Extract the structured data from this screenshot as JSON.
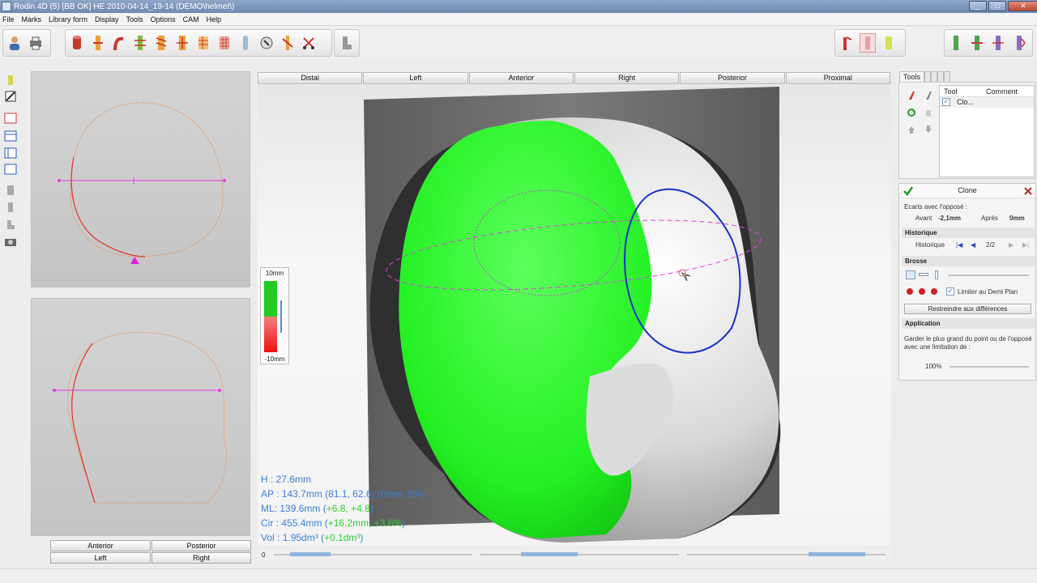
{
  "window": {
    "title": "Rodin 4D (5) [BB OK] HE 2010-04-14_19-14 (DEMO\\helmet\\)",
    "controls": [
      "_",
      "□",
      "✕"
    ]
  },
  "menu": [
    "File",
    "Marks",
    "Library form",
    "Display",
    "Tools",
    "Options",
    "CAM",
    "Help"
  ],
  "view_tabs": [
    "Distal",
    "Left",
    "Anterior",
    "Right",
    "Posterior",
    "Proximal"
  ],
  "left_buttons": {
    "anterior": "Anterior",
    "posterior": "Posterior",
    "left": "Left",
    "right": "Right"
  },
  "scale": {
    "top": "10mm",
    "bottom": "-10mm",
    "colors": {
      "positive": "#22cc22",
      "negative": "#ee1111"
    }
  },
  "stats": {
    "h_label": "H : ",
    "h_value": "27.6mm",
    "ap_label": "AP : ",
    "ap_value": "143.7mm (81.1, 62.6) (0mm, 0%)",
    "ml_label": "ML: ",
    "ml_value": "139.6mm (",
    "ml_delta": "+6.8, +4.8",
    "ml_close": ")",
    "cir_label": "Cir : ",
    "cir_value": "455.4mm (",
    "cir_delta": "+16.2mm, +3.6%",
    "cir_close": ")",
    "vol_label": "Vol : ",
    "vol_value": "1.95dm³ (",
    "vol_delta": "+0.1dm³",
    "vol_close": ")"
  },
  "slider_zero": "0",
  "right_panel": {
    "tab": "Tools",
    "table_headers": [
      "Tool",
      "Comment"
    ],
    "table_rows": [
      {
        "checked": "✓",
        "tool": "Clo..."
      }
    ],
    "clone": {
      "title": "Clone",
      "ecarts_label": "Ecarts avec l'opposé :",
      "avant_label": "Avant",
      "avant_value": "-2,1mm",
      "apres_label": "Après",
      "apres_value": "0mm",
      "historique_section": "Historique",
      "historique_label": "Historique",
      "historique_value": "2/2",
      "brosse_section": "Brosse",
      "limiter_label": "Limiter au Demi Plan",
      "limiter_checked": "✓",
      "restreindre_button": "Restreindre aux différences",
      "application_section": "Application",
      "application_text": "Garder le plus grand du point ou de l'opposé avec une limitation de :",
      "percent": "100%"
    }
  },
  "colors": {
    "green": "#22ff22",
    "ellipse": "#ff44ff",
    "blue_outline": "#1a2fc9",
    "outline_orange": "#f08a4a"
  }
}
